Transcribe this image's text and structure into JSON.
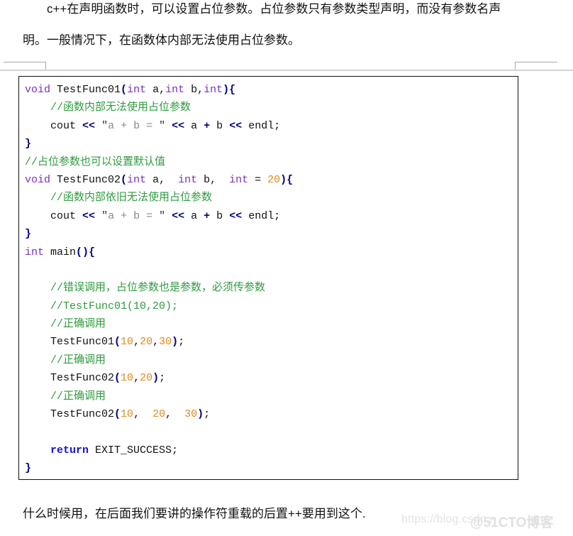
{
  "document": {
    "intro_paragraph": {
      "line1": "c++在声明函数时，可以设置占位参数。占位参数只有参数类型声明，而没有参数名声",
      "line2": "明。一般情况下，在函数体内部无法使用占位参数。"
    },
    "outro_paragraph": "什么时候用，在后面我们要讲的操作符重载的后置++要用到这个.",
    "watermarks": {
      "csdn": "https://blog.csdn.n",
      "cto": "@51CTO博客"
    },
    "colors": {
      "keyword": "#7b2fbe",
      "return": "#1111dd",
      "punctuation": "#000080",
      "number": "#e08a1e",
      "comment": "#2e9b3f",
      "string": "#8a8a8a",
      "border": "#111111",
      "margin_mark": "#a9a9a9",
      "page_rule": "#d3d3d3"
    },
    "code_block": {
      "language": "cpp",
      "lines": [
        {
          "indent": 0,
          "tokens": [
            {
              "t": "kw",
              "v": "void"
            },
            {
              "t": "plain",
              "v": " "
            },
            {
              "t": "fn",
              "v": "TestFunc01"
            },
            {
              "t": "punct",
              "v": "("
            },
            {
              "t": "kw",
              "v": "int"
            },
            {
              "t": "plain",
              "v": " a,"
            },
            {
              "t": "kw",
              "v": "int"
            },
            {
              "t": "plain",
              "v": " b,"
            },
            {
              "t": "kw",
              "v": "int"
            },
            {
              "t": "punct",
              "v": ")"
            },
            {
              "t": "punct",
              "v": "{"
            }
          ]
        },
        {
          "indent": 1,
          "tokens": [
            {
              "t": "cmt",
              "v": "//函数内部无法使用占位参数"
            }
          ]
        },
        {
          "indent": 1,
          "tokens": [
            {
              "t": "plain",
              "v": "cout "
            },
            {
              "t": "op",
              "v": "<<"
            },
            {
              "t": "plain",
              "v": " "
            },
            {
              "t": "strq",
              "v": "\""
            },
            {
              "t": "str",
              "v": "a + b = "
            },
            {
              "t": "strq",
              "v": "\""
            },
            {
              "t": "plain",
              "v": " "
            },
            {
              "t": "op",
              "v": "<<"
            },
            {
              "t": "plain",
              "v": " a "
            },
            {
              "t": "op",
              "v": "+"
            },
            {
              "t": "plain",
              "v": " b "
            },
            {
              "t": "op",
              "v": "<<"
            },
            {
              "t": "plain",
              "v": " endl;"
            }
          ]
        },
        {
          "indent": 0,
          "tokens": [
            {
              "t": "punct",
              "v": "}"
            }
          ]
        },
        {
          "indent": 0,
          "tokens": [
            {
              "t": "cmt",
              "v": "//占位参数也可以设置默认值"
            }
          ]
        },
        {
          "indent": 0,
          "tokens": [
            {
              "t": "kw",
              "v": "void"
            },
            {
              "t": "plain",
              "v": " "
            },
            {
              "t": "fn",
              "v": "TestFunc02"
            },
            {
              "t": "punct",
              "v": "("
            },
            {
              "t": "kw",
              "v": "int"
            },
            {
              "t": "plain",
              "v": " a,  "
            },
            {
              "t": "kw",
              "v": "int"
            },
            {
              "t": "plain",
              "v": " b,  "
            },
            {
              "t": "kw",
              "v": "int"
            },
            {
              "t": "plain",
              "v": " = "
            },
            {
              "t": "num",
              "v": "20"
            },
            {
              "t": "punct",
              "v": ")"
            },
            {
              "t": "punct",
              "v": "{"
            }
          ]
        },
        {
          "indent": 1,
          "tokens": [
            {
              "t": "cmt",
              "v": "//函数内部依旧无法使用占位参数"
            }
          ]
        },
        {
          "indent": 1,
          "tokens": [
            {
              "t": "plain",
              "v": "cout "
            },
            {
              "t": "op",
              "v": "<<"
            },
            {
              "t": "plain",
              "v": " "
            },
            {
              "t": "strq",
              "v": "\""
            },
            {
              "t": "str",
              "v": "a + b = "
            },
            {
              "t": "strq",
              "v": "\""
            },
            {
              "t": "plain",
              "v": " "
            },
            {
              "t": "op",
              "v": "<<"
            },
            {
              "t": "plain",
              "v": " a "
            },
            {
              "t": "op",
              "v": "+"
            },
            {
              "t": "plain",
              "v": " b "
            },
            {
              "t": "op",
              "v": "<<"
            },
            {
              "t": "plain",
              "v": " endl;"
            }
          ]
        },
        {
          "indent": 0,
          "tokens": [
            {
              "t": "punct",
              "v": "}"
            }
          ]
        },
        {
          "indent": 0,
          "tokens": [
            {
              "t": "kw",
              "v": "int"
            },
            {
              "t": "plain",
              "v": " "
            },
            {
              "t": "fn",
              "v": "main"
            },
            {
              "t": "punct",
              "v": "()"
            },
            {
              "t": "punct",
              "v": "{"
            }
          ]
        },
        {
          "indent": 0,
          "tokens": []
        },
        {
          "indent": 1,
          "tokens": [
            {
              "t": "cmt",
              "v": "//错误调用，占位参数也是参数，必须传参数"
            }
          ]
        },
        {
          "indent": 1,
          "tokens": [
            {
              "t": "cmt",
              "v": "//TestFunc01(10,20);"
            }
          ]
        },
        {
          "indent": 1,
          "tokens": [
            {
              "t": "cmt",
              "v": "//正确调用"
            }
          ]
        },
        {
          "indent": 1,
          "tokens": [
            {
              "t": "fn",
              "v": "TestFunc01"
            },
            {
              "t": "punct",
              "v": "("
            },
            {
              "t": "num",
              "v": "10"
            },
            {
              "t": "plain",
              "v": ","
            },
            {
              "t": "num",
              "v": "20"
            },
            {
              "t": "plain",
              "v": ","
            },
            {
              "t": "num",
              "v": "30"
            },
            {
              "t": "punct",
              "v": ")"
            },
            {
              "t": "plain",
              "v": ";"
            }
          ]
        },
        {
          "indent": 1,
          "tokens": [
            {
              "t": "cmt",
              "v": "//正确调用"
            }
          ]
        },
        {
          "indent": 1,
          "tokens": [
            {
              "t": "fn",
              "v": "TestFunc02"
            },
            {
              "t": "punct",
              "v": "("
            },
            {
              "t": "num",
              "v": "10"
            },
            {
              "t": "plain",
              "v": ","
            },
            {
              "t": "num",
              "v": "20"
            },
            {
              "t": "punct",
              "v": ")"
            },
            {
              "t": "plain",
              "v": ";"
            }
          ]
        },
        {
          "indent": 1,
          "tokens": [
            {
              "t": "cmt",
              "v": "//正确调用"
            }
          ]
        },
        {
          "indent": 1,
          "tokens": [
            {
              "t": "fn",
              "v": "TestFunc02"
            },
            {
              "t": "punct",
              "v": "("
            },
            {
              "t": "num",
              "v": "10"
            },
            {
              "t": "plain",
              "v": ",  "
            },
            {
              "t": "num",
              "v": "20"
            },
            {
              "t": "plain",
              "v": ",  "
            },
            {
              "t": "num",
              "v": "30"
            },
            {
              "t": "punct",
              "v": ")"
            },
            {
              "t": "plain",
              "v": ";"
            }
          ]
        },
        {
          "indent": 0,
          "tokens": []
        },
        {
          "indent": 1,
          "tokens": [
            {
              "t": "ret",
              "v": "return"
            },
            {
              "t": "plain",
              "v": " EXIT_SUCCESS;"
            }
          ]
        },
        {
          "indent": 0,
          "tokens": [
            {
              "t": "punct",
              "v": "}"
            }
          ]
        }
      ]
    }
  }
}
